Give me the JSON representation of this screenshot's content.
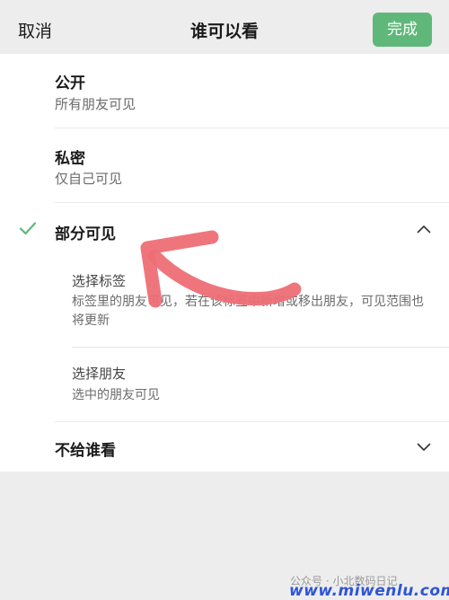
{
  "header": {
    "cancel_label": "取消",
    "title": "谁可以看",
    "done_label": "完成"
  },
  "options": {
    "public": {
      "title": "公开",
      "subtitle": "所有朋友可见"
    },
    "private": {
      "title": "私密",
      "subtitle": "仅自己可见"
    },
    "partial": {
      "title": "部分可见",
      "selected": true,
      "expanded": true,
      "sub_options": {
        "tags": {
          "title": "选择标签",
          "description": "标签里的朋友可见，若在该标签中新增或移出朋友，可见范围也将更新"
        },
        "friends": {
          "title": "选择朋友",
          "description": "选中的朋友可见"
        }
      }
    },
    "exclude": {
      "title": "不给谁看",
      "expanded": false
    }
  },
  "icons": {
    "selected": "checkmark-icon",
    "expanded": "chevron-up-icon",
    "collapsed": "chevron-down-icon"
  },
  "colors": {
    "accent": "#5fb87a",
    "annotation_arrow": "#ee6e76",
    "background": "#ededed"
  },
  "watermark": {
    "line1": "公众号 · 小北数码日记",
    "line2": "www.miwenlu.com"
  }
}
